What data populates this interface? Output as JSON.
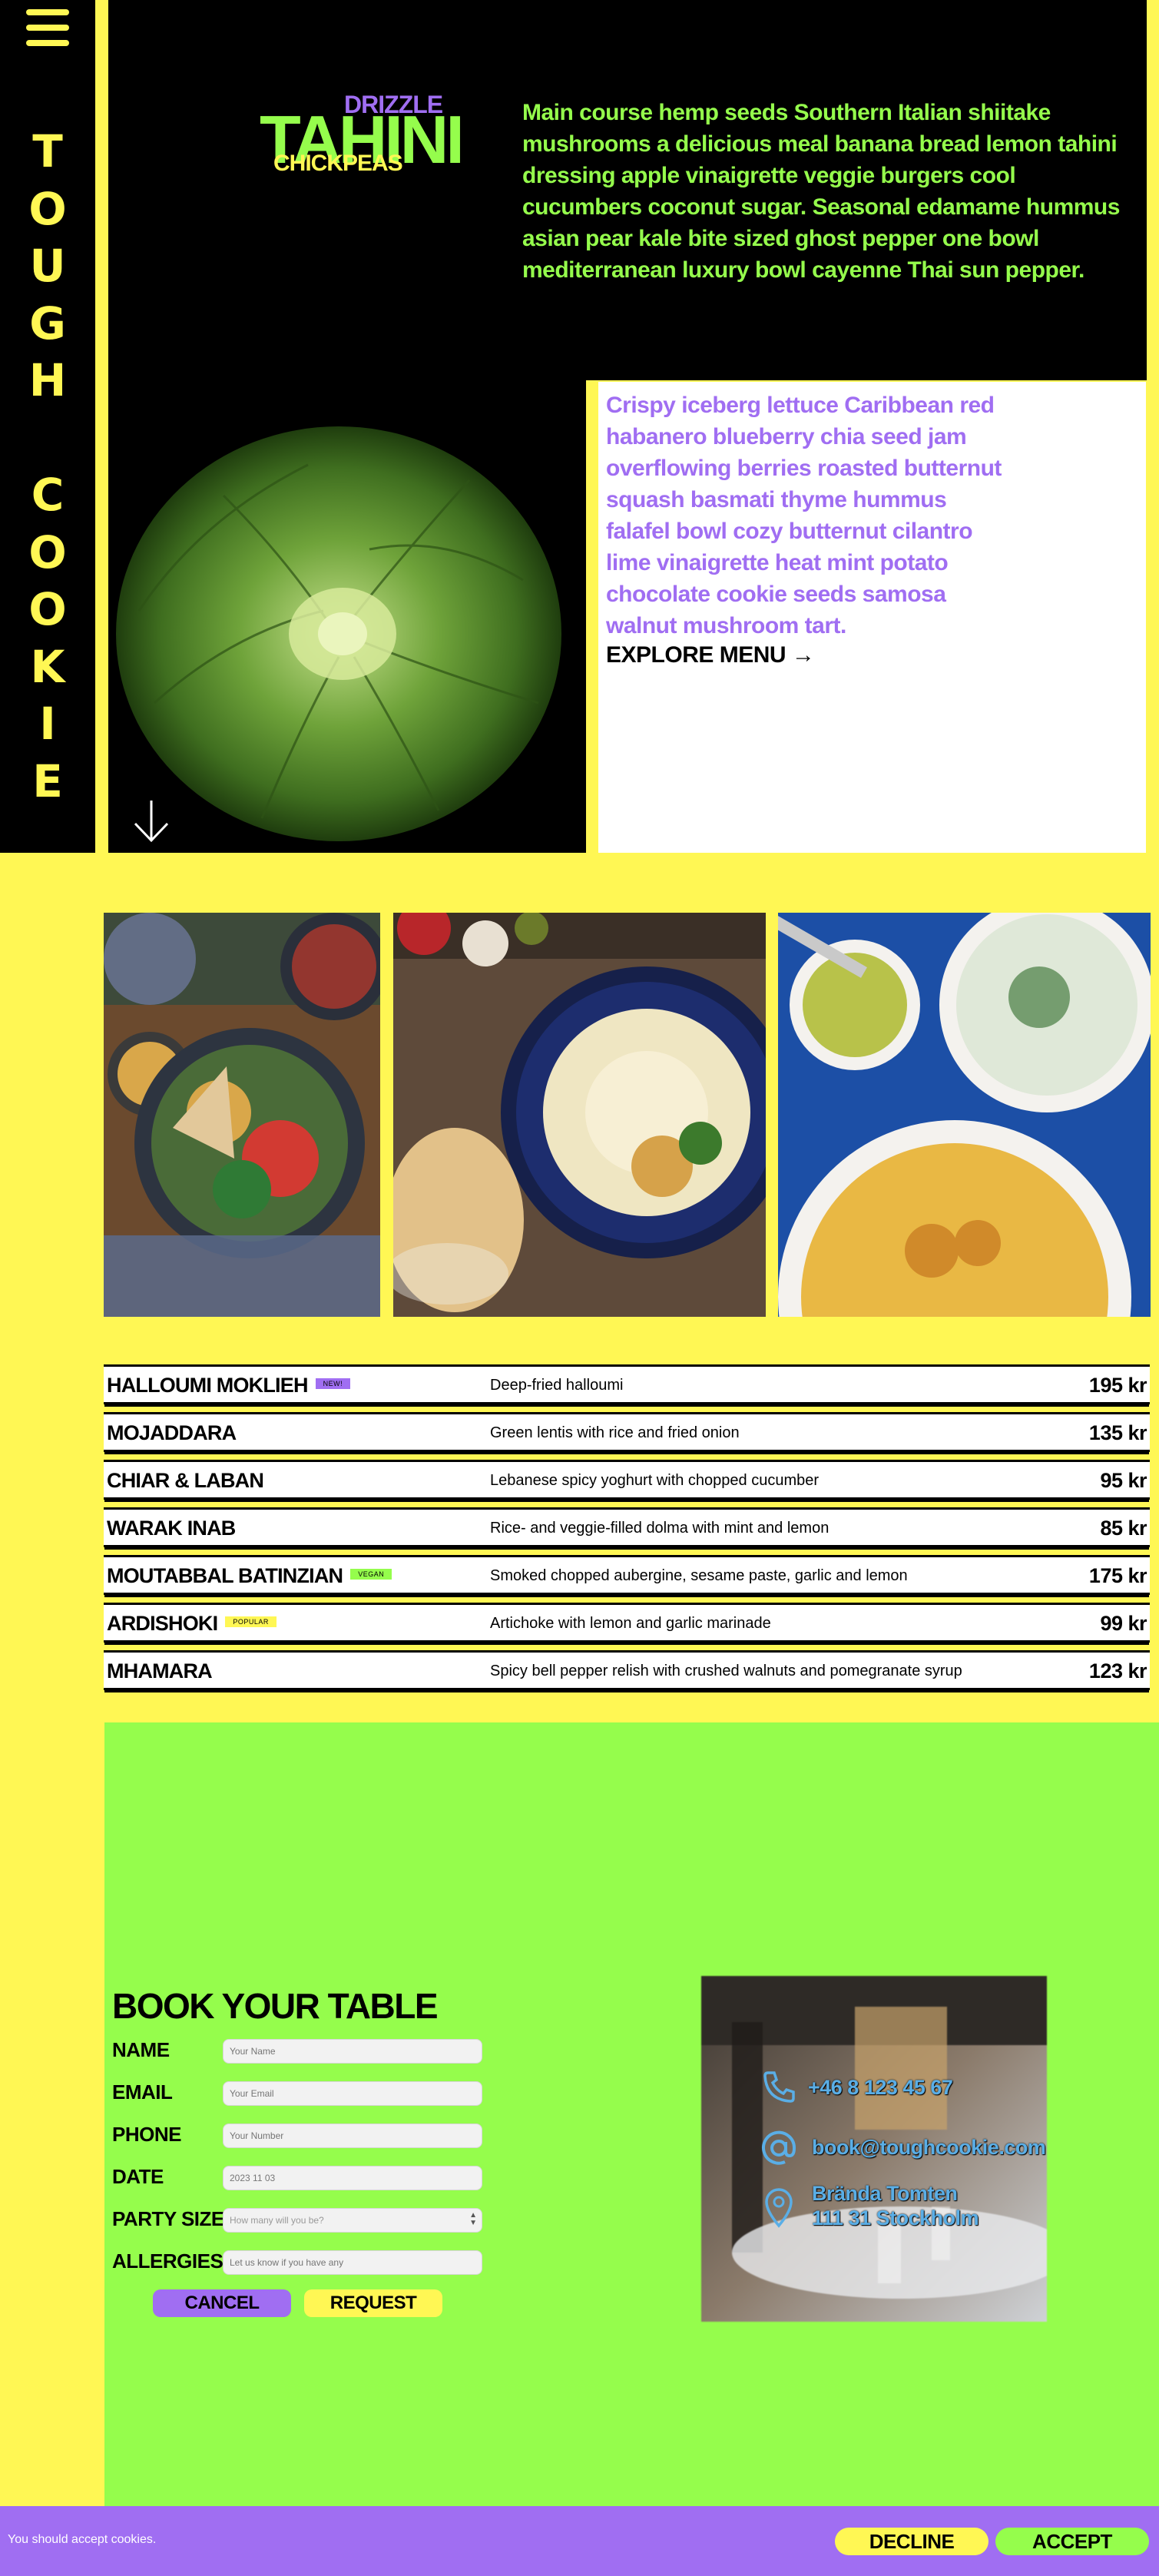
{
  "brand": {
    "letters": [
      "T",
      "O",
      "U",
      "G",
      "H",
      " ",
      "C",
      "O",
      "O",
      "K",
      "I",
      "E"
    ]
  },
  "logo": {
    "top": "DRIZZLE",
    "main": "TAHINI",
    "bottom": "CHICKPEAS"
  },
  "hero": {
    "intro": "Main course hemp seeds Southern Italian shiitake mushrooms a delicious meal banana bread lemon tahini dressing apple vinaigrette veggie burgers cool cucumbers coconut sugar. Seasonal edamame hummus asian pear kale bite sized ghost pepper one bowl mediterranean luxury bowl cayenne Thai sun pepper.",
    "body": "Crispy iceberg lettuce Caribbean red habanero blueberry chia seed jam overflowing berries roasted butternut squash basmati thyme hummus falafel bowl cozy butternut cilantro lime vinaigrette heat mint potato chocolate cookie seeds samosa walnut mushroom tart.",
    "explore_label": "EXPLORE MENU →"
  },
  "menu": {
    "items": [
      {
        "name": "HALLOUMI MOKLIEH",
        "badge": "NEW!",
        "badge_color": "#a06ef2",
        "desc": "Deep-fried halloumi",
        "price": "195 kr"
      },
      {
        "name": "MOJADDARA",
        "badge": "",
        "badge_color": "",
        "desc": "Green lentis with rice and fried onion",
        "price": "135 kr"
      },
      {
        "name": "CHIAR & LABAN",
        "badge": "",
        "badge_color": "",
        "desc": "Lebanese spicy yoghurt with chopped cucumber",
        "price": "95 kr"
      },
      {
        "name": "WARAK INAB",
        "badge": "",
        "badge_color": "",
        "desc": "Rice- and veggie-filled dolma with mint and lemon",
        "price": "85 kr"
      },
      {
        "name": "MOUTABBAL BATINZIAN",
        "badge": "VEGAN",
        "badge_color": "#95fd4c",
        "desc": "Smoked chopped aubergine, sesame paste, garlic and lemon",
        "price": "175 kr"
      },
      {
        "name": "ARDISHOKI",
        "badge": "POPULAR",
        "badge_color": "#fff754",
        "desc": "Artichoke with lemon and garlic marinade",
        "price": "99 kr"
      },
      {
        "name": "MHAMARA",
        "badge": "",
        "badge_color": "",
        "desc": "Spicy bell pepper relish with crushed walnuts and pomegranate syrup",
        "price": "123 kr"
      }
    ]
  },
  "booking": {
    "title": "BOOK YOUR TABLE",
    "fields": {
      "name": {
        "label": "NAME",
        "placeholder": "Your Name"
      },
      "email": {
        "label": "EMAIL",
        "placeholder": "Your Email"
      },
      "phone": {
        "label": "PHONE",
        "placeholder": "Your Number"
      },
      "date": {
        "label": "DATE",
        "value": "2023   11   03"
      },
      "party": {
        "label": "PARTY SIZE",
        "placeholder": "How many will you be?"
      },
      "allergies": {
        "label": "ALLERGIES",
        "placeholder": "Let us know if you have any"
      }
    },
    "cancel_label": "CANCEL",
    "request_label": "REQUEST",
    "cancel_color": "#a06ef2",
    "request_color": "#fff754"
  },
  "contact": {
    "phone": "+46 8 123 45 67",
    "email": "book@toughcookie.com",
    "address_line1": "Brända Tomten",
    "address_line2": "111 31 Stockholm"
  },
  "cookie": {
    "text": "You should accept cookies.",
    "decline_label": "DECLINE",
    "accept_label": "ACCEPT"
  },
  "colors": {
    "yellow": "#fff754",
    "green": "#95fd4c",
    "purple": "#a06ef2",
    "black": "#000000",
    "contact_blue": "#5aaee6"
  },
  "icons": [
    "hamburger-menu-icon",
    "arrow-down-icon",
    "arrow-right-icon",
    "phone-icon",
    "at-icon",
    "location-pin-icon"
  ]
}
